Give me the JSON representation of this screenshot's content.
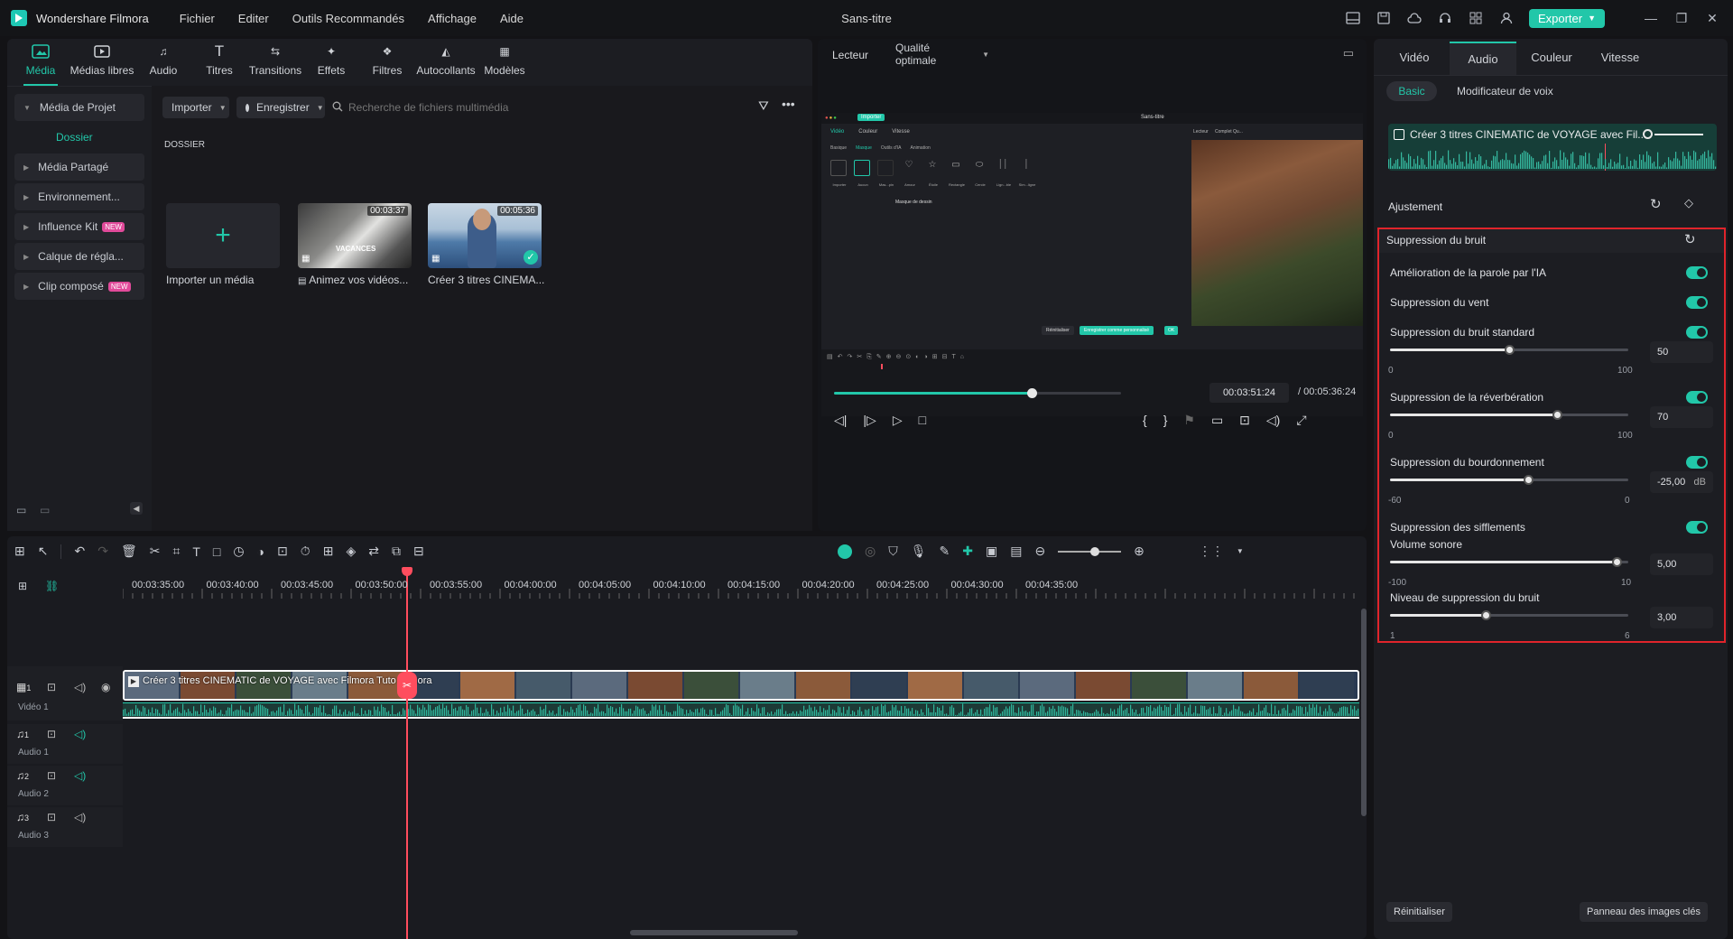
{
  "app": {
    "name": "Wondershare Filmora",
    "window_title": "Sans-titre",
    "menu": [
      "Fichier",
      "Editer",
      "Outils Recommandés",
      "Affichage",
      "Aide"
    ],
    "export_label": "Exporter"
  },
  "media_toolbar": {
    "tools": [
      {
        "label": "Média",
        "icon": "media-icon",
        "active": true
      },
      {
        "label": "Médias libres",
        "icon": "stock-media-icon"
      },
      {
        "label": "Audio",
        "icon": "music-icon"
      },
      {
        "label": "Titres",
        "icon": "text-icon"
      },
      {
        "label": "Transitions",
        "icon": "transition-icon"
      },
      {
        "label": "Effets",
        "icon": "effects-icon"
      },
      {
        "label": "Filtres",
        "icon": "filters-icon"
      },
      {
        "label": "Autocollants",
        "icon": "sticker-icon"
      },
      {
        "label": "Modèles",
        "icon": "templates-icon"
      }
    ]
  },
  "media_sidebar": {
    "items": [
      {
        "label": "Média de Projet",
        "expandable": true
      },
      {
        "label": "Dossier",
        "selected": true
      },
      {
        "label": "Média Partagé",
        "expandable": true
      },
      {
        "label": "Environnement...",
        "expandable": true
      },
      {
        "label": "Influence Kit",
        "expandable": true,
        "badge": "NEW"
      },
      {
        "label": "Calque de régla...",
        "expandable": true
      },
      {
        "label": "Clip composé",
        "expandable": true,
        "badge": "NEW"
      }
    ]
  },
  "media_main": {
    "import_label": "Importer",
    "record_label": "Enregistrer",
    "search_placeholder": "Recherche de fichiers multimédia",
    "folder_heading": "DOSSIER",
    "import_tile_label": "Importer un média",
    "clips": [
      {
        "title": "Animez vos vidéos...",
        "duration": "00:03:37",
        "thumb_text": "VACANCES"
      },
      {
        "title": "Créer 3 titres CINEMA...",
        "duration": "00:05:36",
        "checked": true
      }
    ]
  },
  "player": {
    "label": "Lecteur",
    "quality": "Qualité optimale",
    "current_time": "00:03:51:24",
    "total_time": "/ 00:05:36:24",
    "progress": 0.69,
    "preview": {
      "import_btn": "Importer",
      "title": "Sans-titre",
      "tabs": [
        "Vidéo",
        "Couleur",
        "Vitesse"
      ],
      "subtabs": [
        "Basique",
        "Masque",
        "Outils d'IA",
        "Animation"
      ],
      "mask_items": [
        "Importer",
        "Aucun",
        "Mas...pin",
        "Amour",
        "Étoile",
        "Rectangle",
        "Cercle",
        "Lign...ble",
        "Sim...ligne"
      ],
      "mask_caption": "Masque de dessin",
      "reset": "Réinitialiser",
      "save": "Enregistrer comme personnalisé",
      "ok": "OK",
      "player_label": "Lecteur",
      "quality": "Complet Qu..."
    }
  },
  "right_panel": {
    "tabs": [
      "Vidéo",
      "Audio",
      "Couleur",
      "Vitesse"
    ],
    "active_tab": "Audio",
    "subtabs": [
      "Basic",
      "Modificateur de voix"
    ],
    "audio_clip_title": "Créer 3 titres CINEMATIC de VOYAGE avec Fil...",
    "section_ajustement": "Ajustement",
    "noise_section_title": "Suppression du bruit",
    "toggles": [
      {
        "label": "Amélioration de la parole par l'IA",
        "on": true
      },
      {
        "label": "Suppression du vent",
        "on": true
      },
      {
        "label": "Suppression du bruit standard",
        "on": true,
        "value": "50",
        "min": "0",
        "max": "100",
        "level": 0.5
      },
      {
        "label": "Suppression de la réverbération",
        "on": true,
        "value": "70",
        "min": "0",
        "max": "100",
        "level": 0.7
      },
      {
        "label": "Suppression du bourdonnement",
        "on": true,
        "value": "-25,00",
        "unit": "dB",
        "min": "-60",
        "max": "0",
        "level": 0.58
      },
      {
        "label": "Suppression des sifflements",
        "on": true
      }
    ],
    "volume_label": "Volume sonore",
    "volume": {
      "value": "5,00",
      "min": "-100",
      "max": "10",
      "level": 0.95
    },
    "noise_level_label": "Niveau de suppression du bruit",
    "noise_level": {
      "value": "3,00",
      "min": "1",
      "max": "6",
      "level": 0.4
    },
    "reset_label": "Réinitialiser",
    "keyframes_label": "Panneau des images clés",
    "highlight_color": "#e0242b"
  },
  "timeline": {
    "ruler": [
      "00:03:35:00",
      "00:03:40:00",
      "00:03:45:00",
      "00:03:50:00",
      "00:03:55:00",
      "00:04:00:00",
      "00:04:05:00",
      "00:04:10:00",
      "00:04:15:00",
      "00:04:20:00",
      "00:04:25:00",
      "00:04:30:00",
      "00:04:35:00"
    ],
    "video_clip_title": "Créer 3 titres CINEMATIC de VOYAGE avec Filmora  Tuto Filmora",
    "tracks": [
      {
        "label": "Vidéo 1",
        "num": "1"
      },
      {
        "label": "Audio 1",
        "num": "1"
      },
      {
        "label": "Audio 2",
        "num": "2"
      },
      {
        "label": "Audio 3",
        "num": "3"
      }
    ],
    "accent": "#22c7a9",
    "playhead_color": "#ff4d5e"
  }
}
